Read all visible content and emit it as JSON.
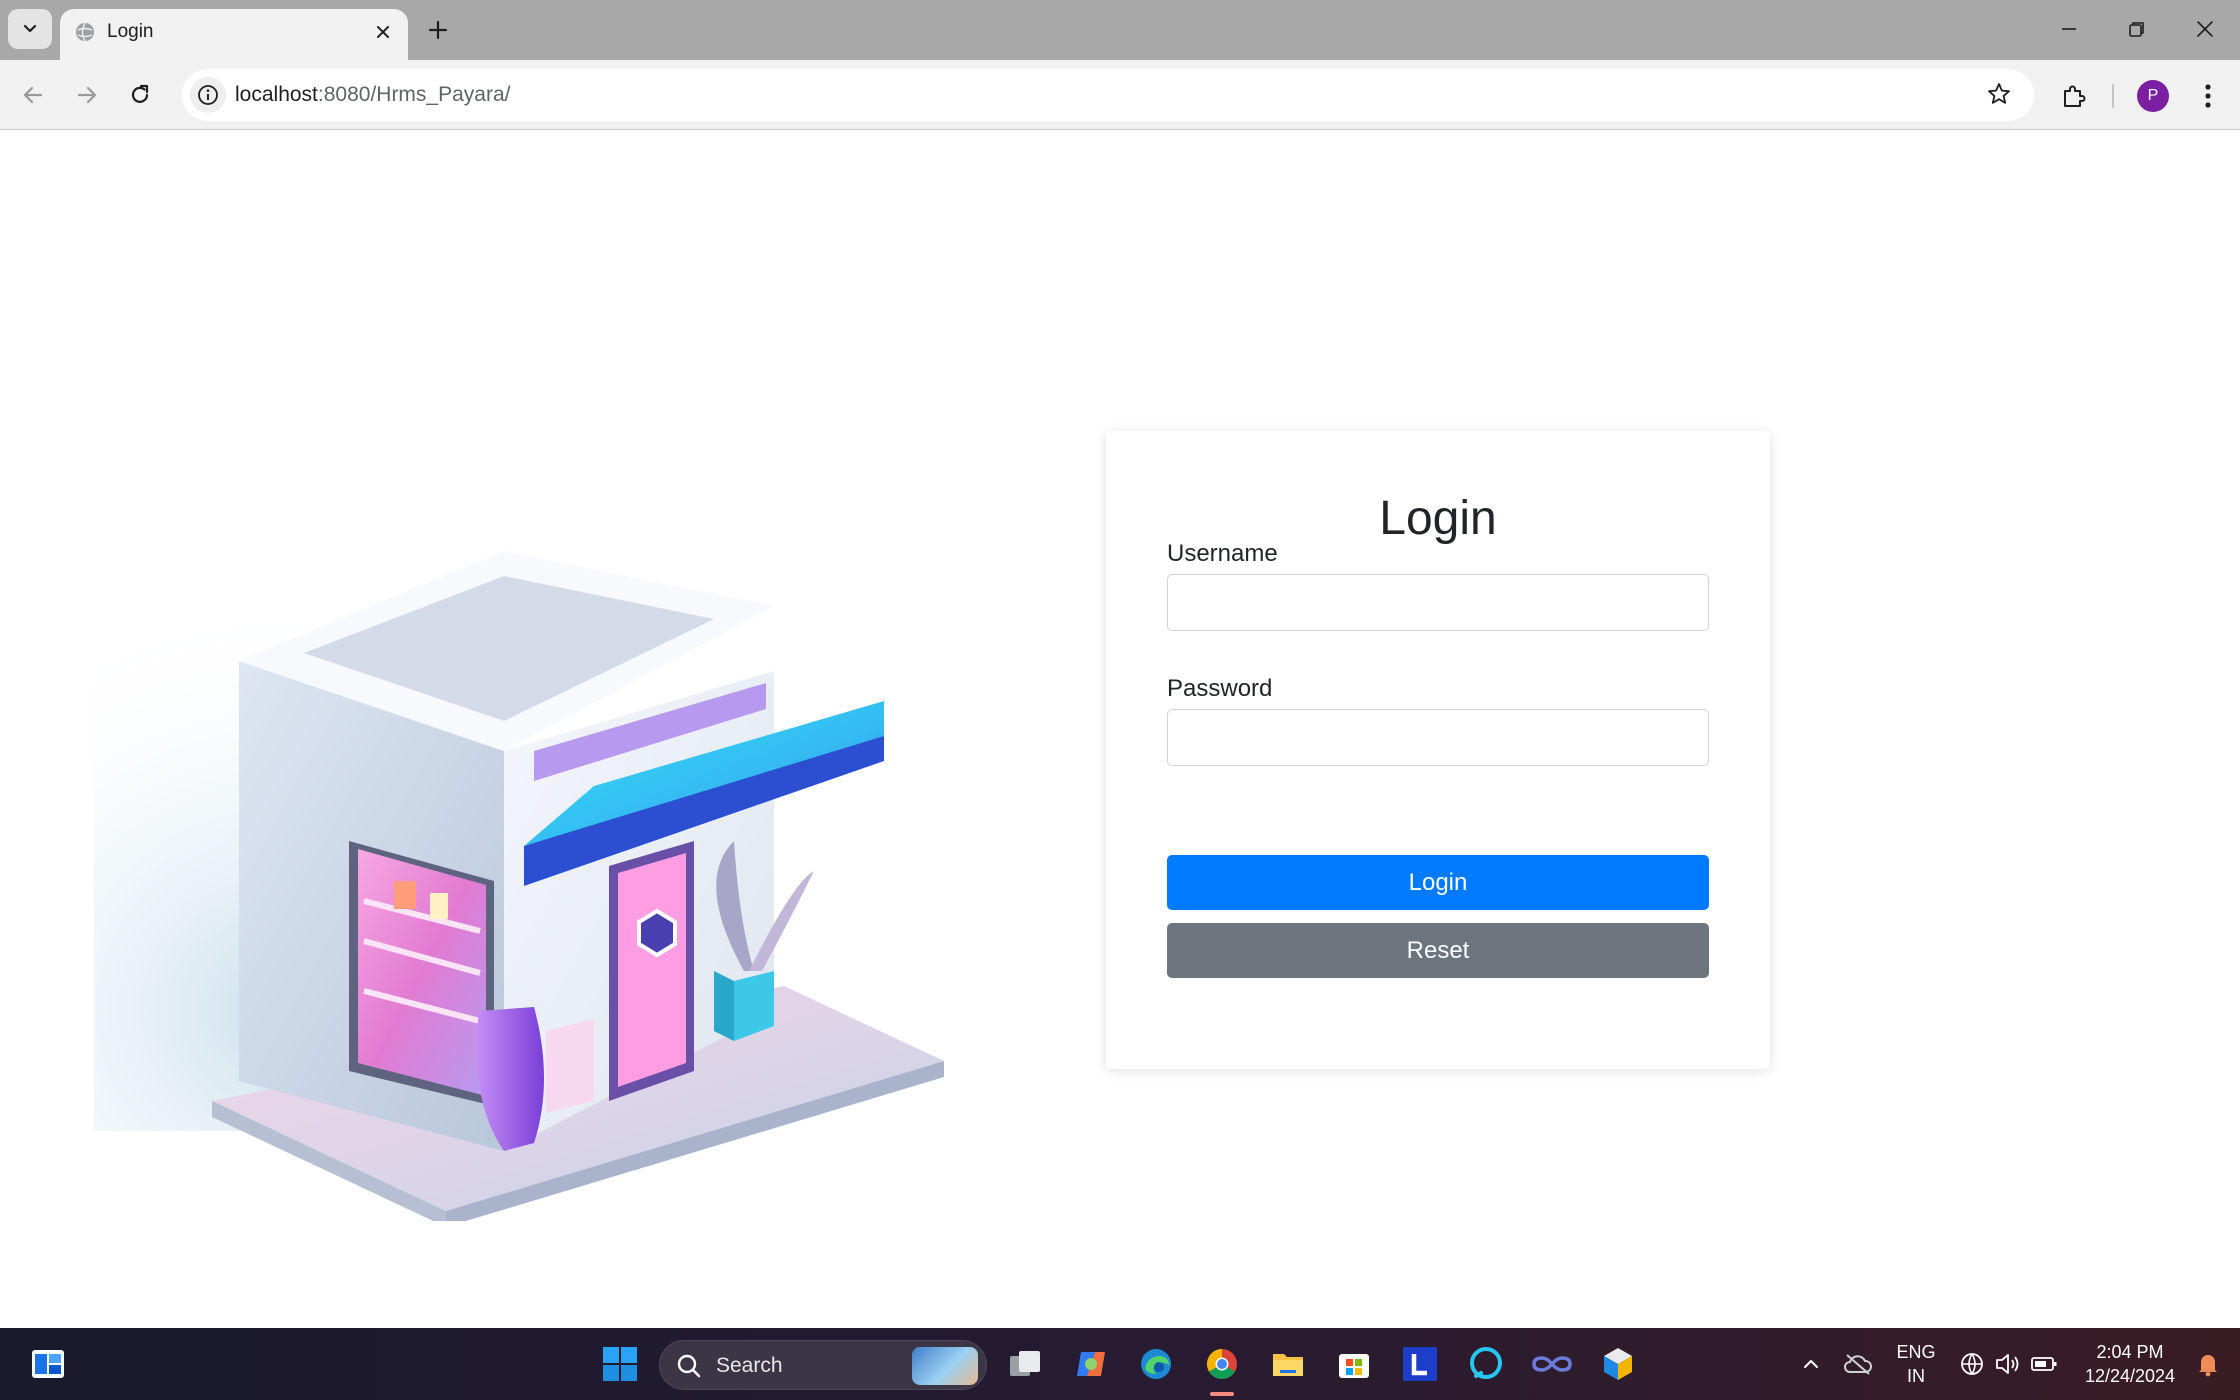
{
  "browser": {
    "tab_title": "Login",
    "url_host": "localhost",
    "url_path": ":8080/Hrms_Payara/",
    "profile_initial": "P"
  },
  "login": {
    "title": "Login",
    "username_label": "Username",
    "username_value": "",
    "password_label": "Password",
    "password_value": "",
    "login_button": "Login",
    "reset_button": "Reset"
  },
  "taskbar": {
    "search_label": "Search",
    "lang_line1": "ENG",
    "lang_line2": "IN",
    "time": "2:04 PM",
    "date": "12/24/2024"
  },
  "colors": {
    "primary": "#007bff",
    "secondary": "#6c757d",
    "avatar": "#7b1fa2"
  }
}
